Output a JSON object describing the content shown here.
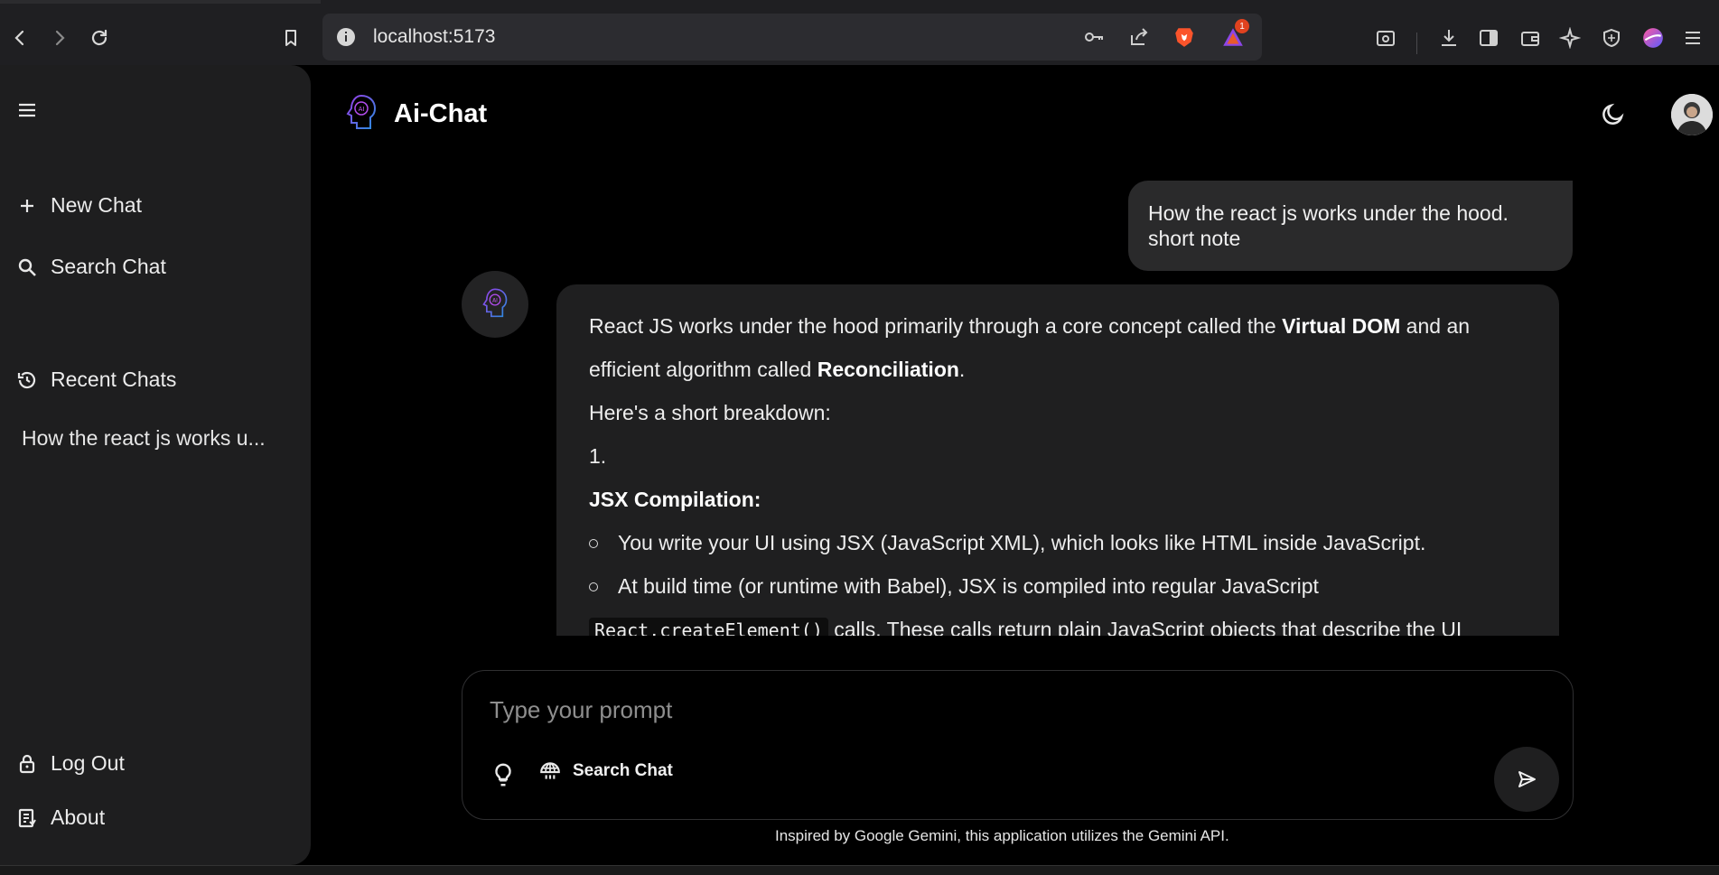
{
  "browser": {
    "url": "localhost:5173",
    "notification_count": "1"
  },
  "sidebar": {
    "new_chat": "New Chat",
    "search_chat": "Search Chat",
    "recent_title": "Recent Chats",
    "recent_items": [
      "How the react js works u..."
    ],
    "logout": "Log Out",
    "about": "About"
  },
  "header": {
    "title": "Ai-Chat"
  },
  "chat": {
    "user_message": "How the react js works under the hood. short note",
    "bot": {
      "intro_a": "React JS works under the hood primarily through a core concept called the ",
      "intro_b1": "Virtual DOM",
      "intro_c": " and an efficient algorithm called ",
      "intro_b2": "Reconciliation",
      "intro_d": ".",
      "breakdown": "Here's a short breakdown:",
      "num": "1.",
      "step_title": "JSX Compilation:",
      "bullet1": "You write your UI using JSX (JavaScript XML), which looks like HTML inside JavaScript.",
      "bullet2": "At build time (or runtime with Babel), JSX is compiled into regular JavaScript",
      "code": "React.createElement()",
      "bullet2_cont": " calls. These calls return plain JavaScript objects that describe the UI"
    }
  },
  "composer": {
    "placeholder": "Type your prompt",
    "search_label": "Search Chat"
  },
  "footer": "Inspired by Google Gemini, this application utilizes the Gemini API.",
  "colors": {
    "background": "#000000",
    "sidebar": "#1e1e1f",
    "bubble": "#2a2a2b",
    "accent": "#7b3fe4"
  }
}
